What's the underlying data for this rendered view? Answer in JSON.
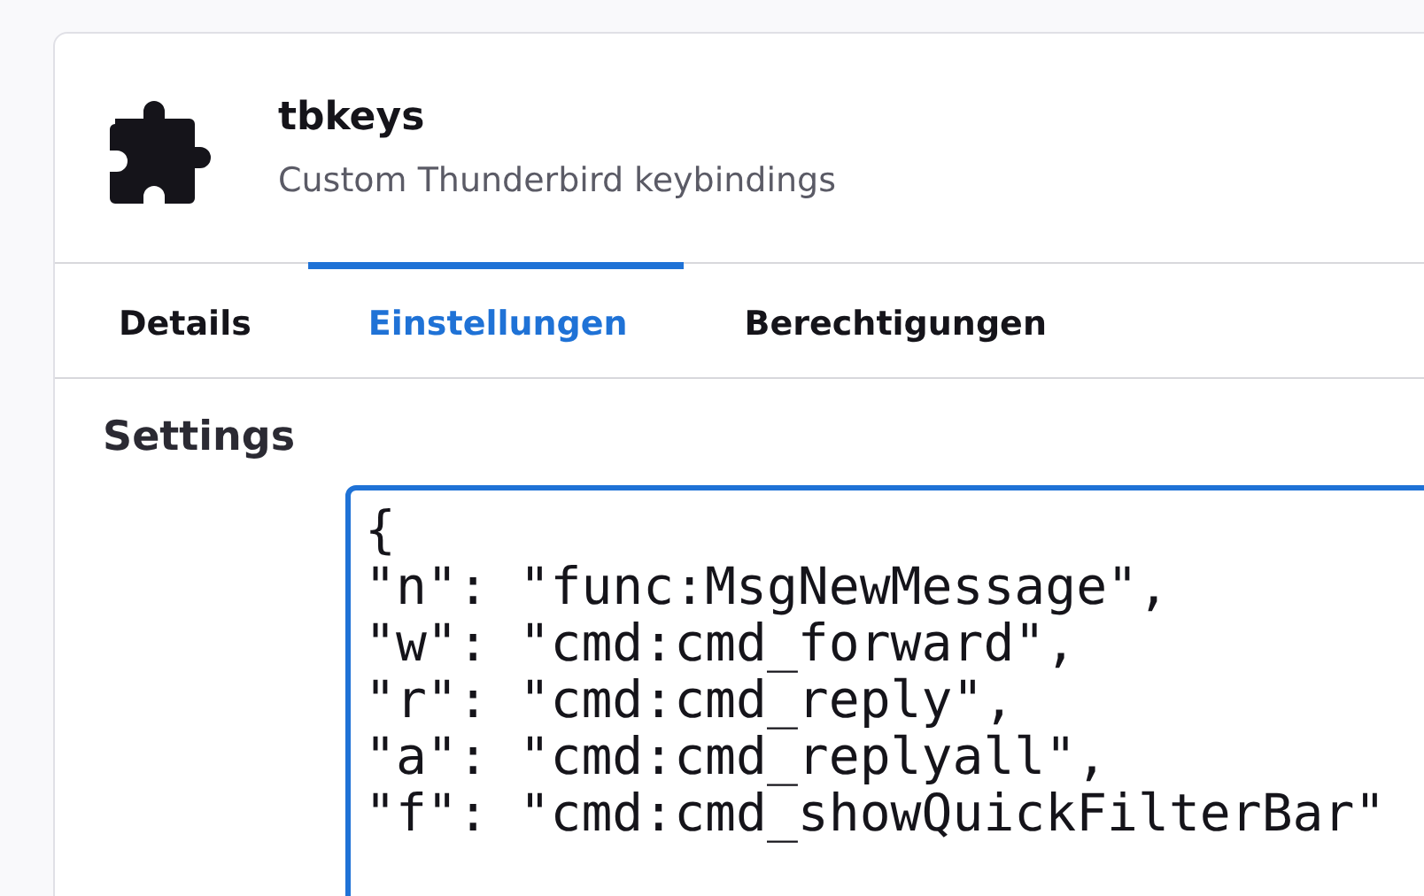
{
  "addon": {
    "name": "tbkeys",
    "description": "Custom Thunderbird keybindings"
  },
  "tabs": [
    {
      "label": "Details",
      "selected": false
    },
    {
      "label": "Einstellungen",
      "selected": true
    },
    {
      "label": "Berechtigungen",
      "selected": false
    }
  ],
  "settings": {
    "heading": "Settings",
    "value": "{\n\"n\": \"func:MsgNewMessage\",\n\"w\": \"cmd:cmd_forward\",\n\"r\": \"cmd:cmd_reply\",\n\"a\": \"cmd:cmd_replyall\",\n\"f\": \"cmd:cmd_showQuickFilterBar\""
  }
}
